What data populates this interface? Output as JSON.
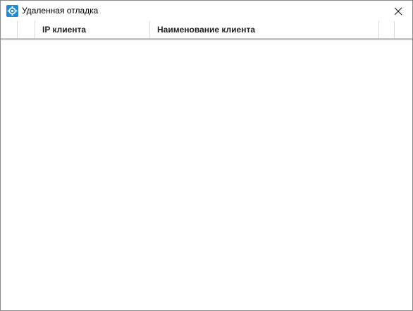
{
  "window": {
    "title": "Удаленная отладка",
    "icon": "gear-icon",
    "accent": "#1f8bd0"
  },
  "table": {
    "columns": [
      {
        "id": "marker",
        "label": ""
      },
      {
        "id": "select",
        "label": ""
      },
      {
        "id": "ip",
        "label": "IP клиента"
      },
      {
        "id": "name",
        "label": "Наименование клиента"
      },
      {
        "id": "extra1",
        "label": ""
      },
      {
        "id": "extra2",
        "label": ""
      }
    ],
    "rows": []
  }
}
